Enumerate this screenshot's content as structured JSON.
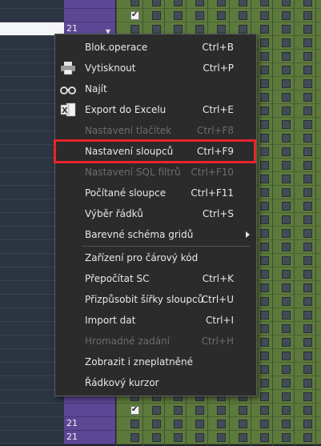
{
  "grid": {
    "cell_value": "21",
    "rows_with_value": [
      1,
      30,
      31
    ],
    "checked_rows": [
      0,
      29,
      32
    ]
  },
  "menu": {
    "items": [
      {
        "label": "Blok.operace",
        "shortcut": "Ctrl+B",
        "disabled": false,
        "icon": ""
      },
      {
        "label": "Vytisknout",
        "shortcut": "Ctrl+P",
        "disabled": false,
        "icon": "printer-icon"
      },
      {
        "label": "Najít",
        "shortcut": "",
        "disabled": false,
        "icon": "binoculars-icon"
      },
      {
        "label": "Export do Excelu",
        "shortcut": "Ctrl+E",
        "disabled": false,
        "icon": "excel-icon"
      },
      {
        "label": "Nastavení tlačítek",
        "shortcut": "Ctrl+F8",
        "disabled": true,
        "icon": ""
      },
      {
        "label": "Nastavení sloupců",
        "shortcut": "Ctrl+F9",
        "disabled": false,
        "icon": ""
      },
      {
        "label": "Nastavení SQL filtrů",
        "shortcut": "Ctrl+F10",
        "disabled": true,
        "icon": ""
      },
      {
        "label": "Počítané sloupce",
        "shortcut": "Ctrl+F11",
        "disabled": false,
        "icon": ""
      },
      {
        "label": "Výběr řádků",
        "shortcut": "Ctrl+S",
        "disabled": false,
        "icon": ""
      },
      {
        "label": "Barevné schéma gridů",
        "shortcut": "",
        "disabled": false,
        "icon": "",
        "submenu": true
      },
      {
        "label": "Zařízení pro čárový kód",
        "shortcut": "",
        "disabled": false,
        "icon": ""
      },
      {
        "label": "Přepočítat SC",
        "shortcut": "Ctrl+K",
        "disabled": false,
        "icon": ""
      },
      {
        "label": "Přizpůsobit šířky sloupců",
        "shortcut": "Ctrl+U",
        "disabled": false,
        "icon": ""
      },
      {
        "label": "Import dat",
        "shortcut": "Ctrl+I",
        "disabled": false,
        "icon": ""
      },
      {
        "label": "Hromadné zadání",
        "shortcut": "Ctrl+H",
        "disabled": true,
        "icon": ""
      },
      {
        "label": "Zobrazit i zneplatněné",
        "shortcut": "",
        "disabled": false,
        "icon": ""
      },
      {
        "label": "Řádkový kurzor",
        "shortcut": "",
        "disabled": false,
        "icon": ""
      }
    ]
  },
  "colors": {
    "highlight": "#e8242a",
    "menu_bg": "#2b2b2b",
    "value_col": "#5b4793",
    "check_cols": "#5d7a3d"
  }
}
